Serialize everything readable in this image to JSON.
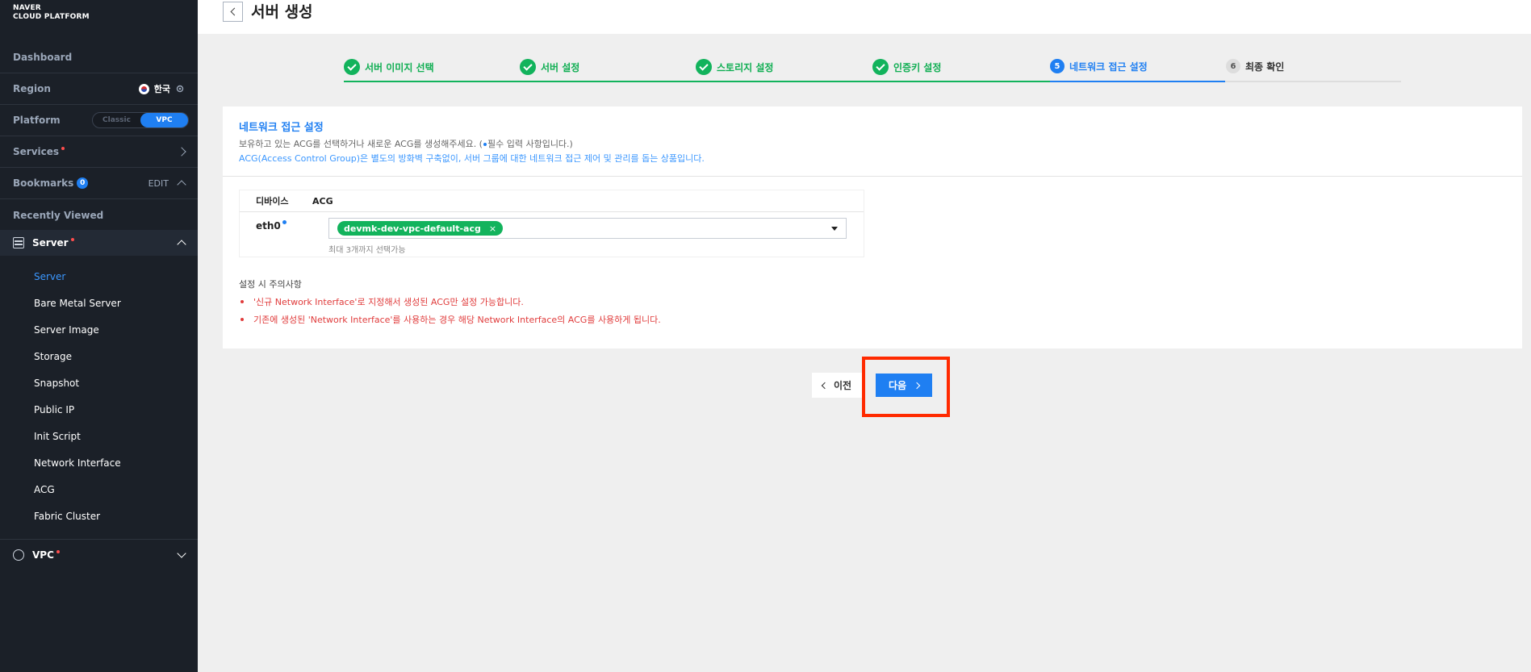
{
  "brand": {
    "line1": "NAVER",
    "line2": "CLOUD PLATFORM"
  },
  "sidebar": {
    "dashboard": "Dashboard",
    "region": {
      "label": "Region",
      "value": "한국"
    },
    "platform": {
      "label": "Platform",
      "options": [
        "Classic",
        "VPC"
      ],
      "selected": "VPC"
    },
    "services": "Services",
    "bookmarks": {
      "label": "Bookmarks",
      "count": "0",
      "edit": "EDIT"
    },
    "recently_viewed": "Recently Viewed",
    "server_group": "Server",
    "server_items": [
      "Server",
      "Bare Metal Server",
      "Server Image",
      "Storage",
      "Snapshot",
      "Public IP",
      "Init Script",
      "Network Interface",
      "ACG",
      "Fabric Cluster"
    ],
    "vpc": "VPC"
  },
  "header": {
    "title": "서버 생성"
  },
  "steps": [
    {
      "label": "서버 이미지 선택",
      "state": "done"
    },
    {
      "label": "서버 설정",
      "state": "done"
    },
    {
      "label": "스토리지 설정",
      "state": "done"
    },
    {
      "label": "인증키 설정",
      "state": "done"
    },
    {
      "num": "5",
      "label": "네트워크 접근 설정",
      "state": "current"
    },
    {
      "num": "6",
      "label": "최종 확인",
      "state": "pending"
    }
  ],
  "section": {
    "title": "네트워크 접근 설정",
    "desc1_a": "보유하고 있는 ACG를 선택하거나 새로운 ACG를 생성해주세요. (",
    "desc1_b": "필수 입력 사항입니다.)",
    "desc2": "ACG(Access Control Group)은 별도의 방화벽 구축없이, 서버 그룹에 대한 네트워크 접근 제어 및 관리를 돕는 상품입니다."
  },
  "table": {
    "col_device": "디바이스",
    "col_acg": "ACG",
    "device": "eth0",
    "acg_tag": "devmk-dev-vpc-default-acg",
    "tag_remove": "×",
    "hint": "최대 3개까지 선택가능"
  },
  "notices": {
    "title": "설정 시 주의사항",
    "items": [
      "'신규 Network Interface'로 지정해서 생성된 ACG만 설정 가능합니다.",
      "기존에 생성된 'Network Interface'를 사용하는 경우 해당 Network Interface의 ACG를 사용하게 됩니다."
    ]
  },
  "buttons": {
    "prev": "이전",
    "next": "다음"
  },
  "colors": {
    "accent": "#1f7ff2",
    "success": "#12b35c",
    "warning": "#e03b3b",
    "highlight": "#ff2a00",
    "sidebar": "#1b2028"
  }
}
